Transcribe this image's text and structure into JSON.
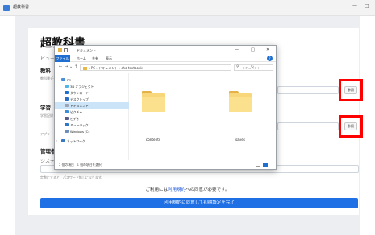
{
  "app": {
    "window_title": "超教科書",
    "minimize": "—",
    "maximize": "□"
  },
  "page": {
    "heading": "超教科書",
    "viewer_label": "ビュー",
    "textbook_section": "教科",
    "textbook_field_label": "教科書データ",
    "student_section": "学習",
    "student_field_label": "学習記録",
    "data_label": "アプリ",
    "admin_section": "管理者",
    "system_label": "システム",
    "password_note": "定数にすると、パスワード無しになります。",
    "browse_label_1": "参照",
    "browse_label_2": "参照",
    "terms_prefix": "ご利用には",
    "terms_link": "利用規約",
    "terms_suffix": "への同意が必要です。",
    "agree_button": "利用規約に同意して初期設定を完了"
  },
  "dialog": {
    "title": "ドキュメント",
    "min": "—",
    "max": "□",
    "close": "✕",
    "ribbon_tabs": [
      "ファイル",
      "ホーム",
      "共有",
      "表示"
    ],
    "help": "?",
    "nav_back": "←",
    "nav_fwd": "→",
    "nav_recent": "⌄",
    "nav_up": "↑",
    "path": "› PC › ドキュメント › cho-textbook",
    "path_drop": "⌄",
    "refresh": "↻",
    "search_icon": "⚲",
    "search_placeholder": "ドキュメント",
    "nav_items": [
      {
        "label": "PC",
        "icon": "pc-icon",
        "color": "#4a90d9",
        "expanded": true
      },
      {
        "label": "3D オブジェクト",
        "icon": "cube-icon",
        "color": "#52b5e8"
      },
      {
        "label": "ダウンロード",
        "icon": "download-icon",
        "color": "#1e6fd0"
      },
      {
        "label": "デスクトップ",
        "icon": "desktop-icon",
        "color": "#2b6cc4"
      },
      {
        "label": "ドキュメント",
        "icon": "documents-icon",
        "color": "#9aa4b2",
        "selected": true
      },
      {
        "label": "ピクチャ",
        "icon": "pictures-icon",
        "color": "#3b8fd8"
      },
      {
        "label": "ビデオ",
        "icon": "video-icon",
        "color": "#5a5a8a"
      },
      {
        "label": "ミュージック",
        "icon": "music-icon",
        "color": "#2f76c9"
      },
      {
        "label": "Windows (C:)",
        "icon": "drive-icon",
        "color": "#6a8fb8"
      },
      {
        "label": "ネットワーク",
        "icon": "network-icon",
        "color": "#3a78c2"
      }
    ],
    "folders": [
      {
        "name": "contents"
      },
      {
        "name": "saves"
      }
    ],
    "status": "2 個の項目　1 個の項目を選択",
    "selection_color": "#cce4f7",
    "accent_color": "#1e6fd0"
  },
  "highlight_color": "#ff0000",
  "primary_color": "#1f6fe5"
}
